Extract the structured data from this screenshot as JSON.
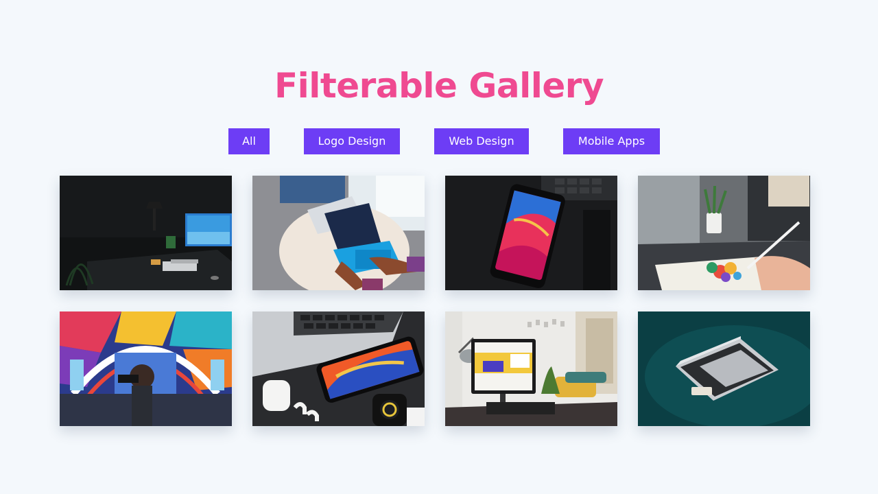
{
  "page": {
    "title": "Filterable Gallery",
    "title_color": "#ef4a91",
    "accent": "#6d3df5"
  },
  "filters": [
    {
      "label": "All",
      "active": true
    },
    {
      "label": "Logo Design",
      "active": false
    },
    {
      "label": "Web Design",
      "active": false
    },
    {
      "label": "Mobile Apps",
      "active": false
    }
  ],
  "gallery": [
    {
      "id": "desk-setup-dark"
    },
    {
      "id": "laptop-round-table"
    },
    {
      "id": "smartphone-dark"
    },
    {
      "id": "stylus-drawing"
    },
    {
      "id": "photographer-colorful-hall"
    },
    {
      "id": "phone-watch-airpods"
    },
    {
      "id": "monitor-living-room"
    },
    {
      "id": "laptop-green-surface"
    }
  ]
}
